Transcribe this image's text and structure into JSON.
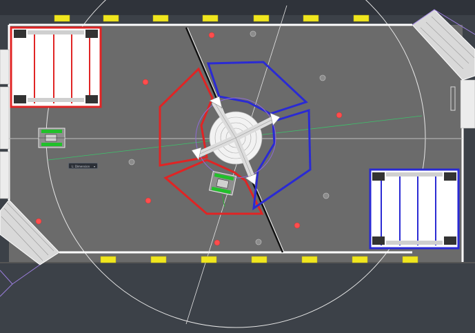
{
  "viewport": {
    "background": "#3c4148",
    "field_color": "#6b6b6b",
    "boundary_color": "#ffffff"
  },
  "alliances": {
    "red": "#e02424",
    "blue": "#2a2ad4"
  },
  "cursor_tooltip": {
    "label": "L: Dimension",
    "icon": "chevron-down-icon"
  },
  "elements": {
    "marker_color": "#f0e61e",
    "red_ball_color": "#ff4d4d",
    "grey_ball_color": "#9a9a9a",
    "robot_color": "#21c02a",
    "guide_line_color": "#3cc46b",
    "hub_ring_color": "#8e6bd6"
  }
}
